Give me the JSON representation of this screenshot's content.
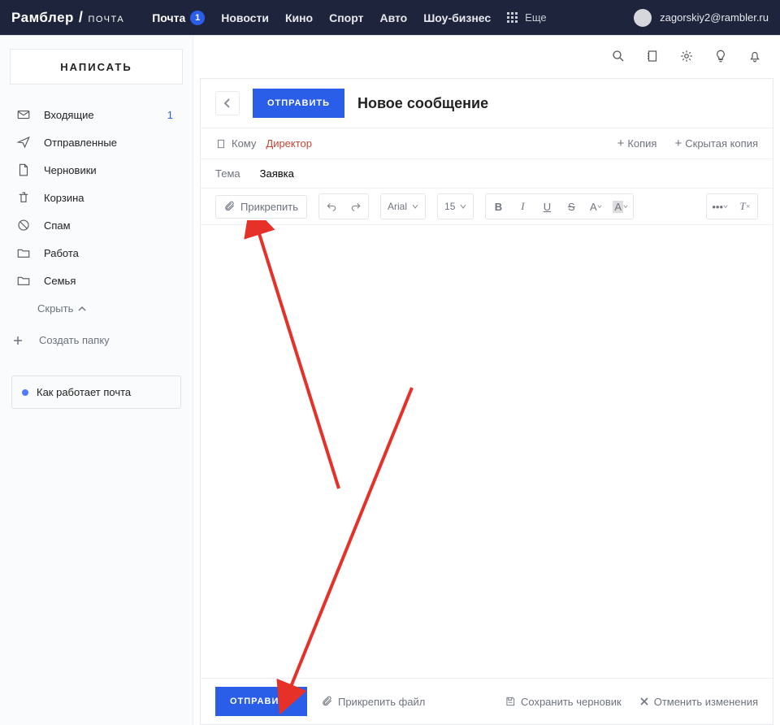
{
  "header": {
    "logo_main": "Рамблер",
    "logo_slash": "/",
    "logo_sub": "ПОЧТА",
    "nav": {
      "mail": "Почта",
      "mail_badge": "1",
      "news": "Новости",
      "kino": "Кино",
      "sport": "Спорт",
      "auto": "Авто",
      "show": "Шоу-бизнес",
      "more": "Еще"
    },
    "user_email": "zagorskiy2@rambler.ru"
  },
  "sidebar": {
    "compose": "НАПИСАТЬ",
    "folders": [
      {
        "key": "inbox",
        "label": "Входящие",
        "count": "1"
      },
      {
        "key": "sent",
        "label": "Отправленные"
      },
      {
        "key": "drafts",
        "label": "Черновики"
      },
      {
        "key": "trash",
        "label": "Корзина"
      },
      {
        "key": "spam",
        "label": "Спам"
      },
      {
        "key": "work",
        "label": "Работа"
      },
      {
        "key": "family",
        "label": "Семья"
      }
    ],
    "collapse": "Скрыть",
    "create_folder": "Создать папку",
    "help": "Как работает почта"
  },
  "composer": {
    "send": "ОТПРАВИТЬ",
    "title": "Новое сообщение",
    "to_label": "Кому",
    "to_value": "Директор",
    "cc": "Копия",
    "bcc": "Скрытая копия",
    "subject_label": "Тема",
    "subject_value": "Заявка",
    "attach": "Прикрепить",
    "font_family": "Arial",
    "font_size": "15",
    "footer": {
      "send": "ОТПРАВИТЬ",
      "attach_file": "Прикрепить файл",
      "save_draft": "Сохранить черновик",
      "cancel": "Отменить изменения"
    }
  }
}
